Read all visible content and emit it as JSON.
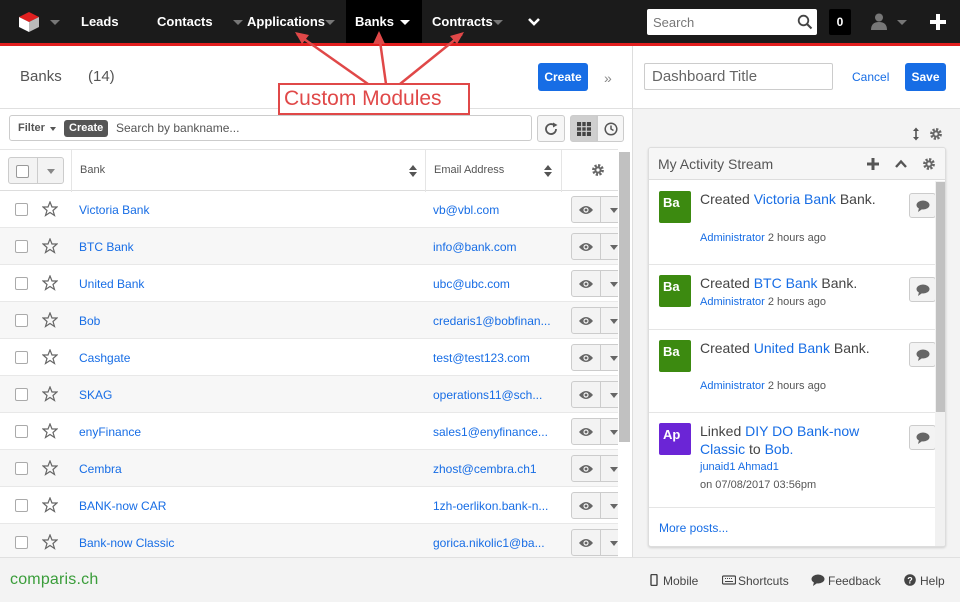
{
  "nav": {
    "items": [
      {
        "label": "Leads",
        "active": false
      },
      {
        "label": "Contacts",
        "active": false
      },
      {
        "label": "Applications",
        "active": false
      },
      {
        "label": "Banks",
        "active": true
      },
      {
        "label": "Contracts",
        "active": false
      }
    ],
    "search_placeholder": "Search",
    "notifications": "0"
  },
  "list": {
    "title": "Banks",
    "count": "(14)",
    "create_label": "Create",
    "filter_label": "Filter",
    "filter_create": "Create",
    "search_placeholder": "Search by bankname...",
    "columns": [
      "Bank",
      "Email Address"
    ],
    "rows": [
      {
        "name": "Victoria Bank",
        "email": "vb@vbl.com"
      },
      {
        "name": "BTC Bank",
        "email": "info@bank.com"
      },
      {
        "name": "United Bank",
        "email": "ubc@ubc.com"
      },
      {
        "name": "Bob",
        "email": "credaris1@bobfinan..."
      },
      {
        "name": "Cashgate",
        "email": "test@test123.com"
      },
      {
        "name": "SKAG",
        "email": "operations11@sch..."
      },
      {
        "name": "enyFinance",
        "email": "sales1@enyfinance..."
      },
      {
        "name": "Cembra",
        "email": "zhost@cembra.ch1"
      },
      {
        "name": "BANK-now CAR",
        "email": "1zh-oerlikon.bank-n..."
      },
      {
        "name": "Bank-now Classic",
        "email": "gorica.nikolic1@ba..."
      }
    ]
  },
  "annotation": {
    "text": "Custom Modules"
  },
  "dashboard": {
    "title_placeholder": "Dashboard Title",
    "cancel_label": "Cancel",
    "save_label": "Save",
    "dashlet_title": "My Activity Stream",
    "activities": [
      {
        "initials": "Ba",
        "color": "#3c8a10",
        "verb": "Created",
        "link": "Victoria Bank",
        "suffix": "Bank.",
        "link2": "",
        "suffix2": "",
        "user": "Administrator",
        "time": "2 hours ago"
      },
      {
        "initials": "Ba",
        "color": "#3c8a10",
        "verb": "Created",
        "link": "BTC Bank",
        "suffix": "Bank.",
        "link2": "",
        "suffix2": "",
        "user": "Administrator",
        "time": "2 hours ago"
      },
      {
        "initials": "Ba",
        "color": "#3c8a10",
        "verb": "Created",
        "link": "United Bank",
        "suffix": "Bank.",
        "link2": "",
        "suffix2": "",
        "user": "Administrator",
        "time": "2 hours ago"
      },
      {
        "initials": "Ap",
        "color": "#6b25d6",
        "verb": "Linked",
        "link": "DIY DO Bank-now Classic",
        "suffix": "to",
        "link2": "Bob.",
        "suffix2": "",
        "user": "junaid1 Ahmad1",
        "time": "on 07/08/2017 03:56pm"
      }
    ],
    "more_posts": "More posts..."
  },
  "footer": {
    "brand": "comparis.ch",
    "mobile": "Mobile",
    "shortcuts": "Shortcuts",
    "feedback": "Feedback",
    "help": "Help"
  },
  "colors": {
    "accent": "#176de5",
    "nav_red": "#e21f1f",
    "annotation": "#e04848"
  }
}
